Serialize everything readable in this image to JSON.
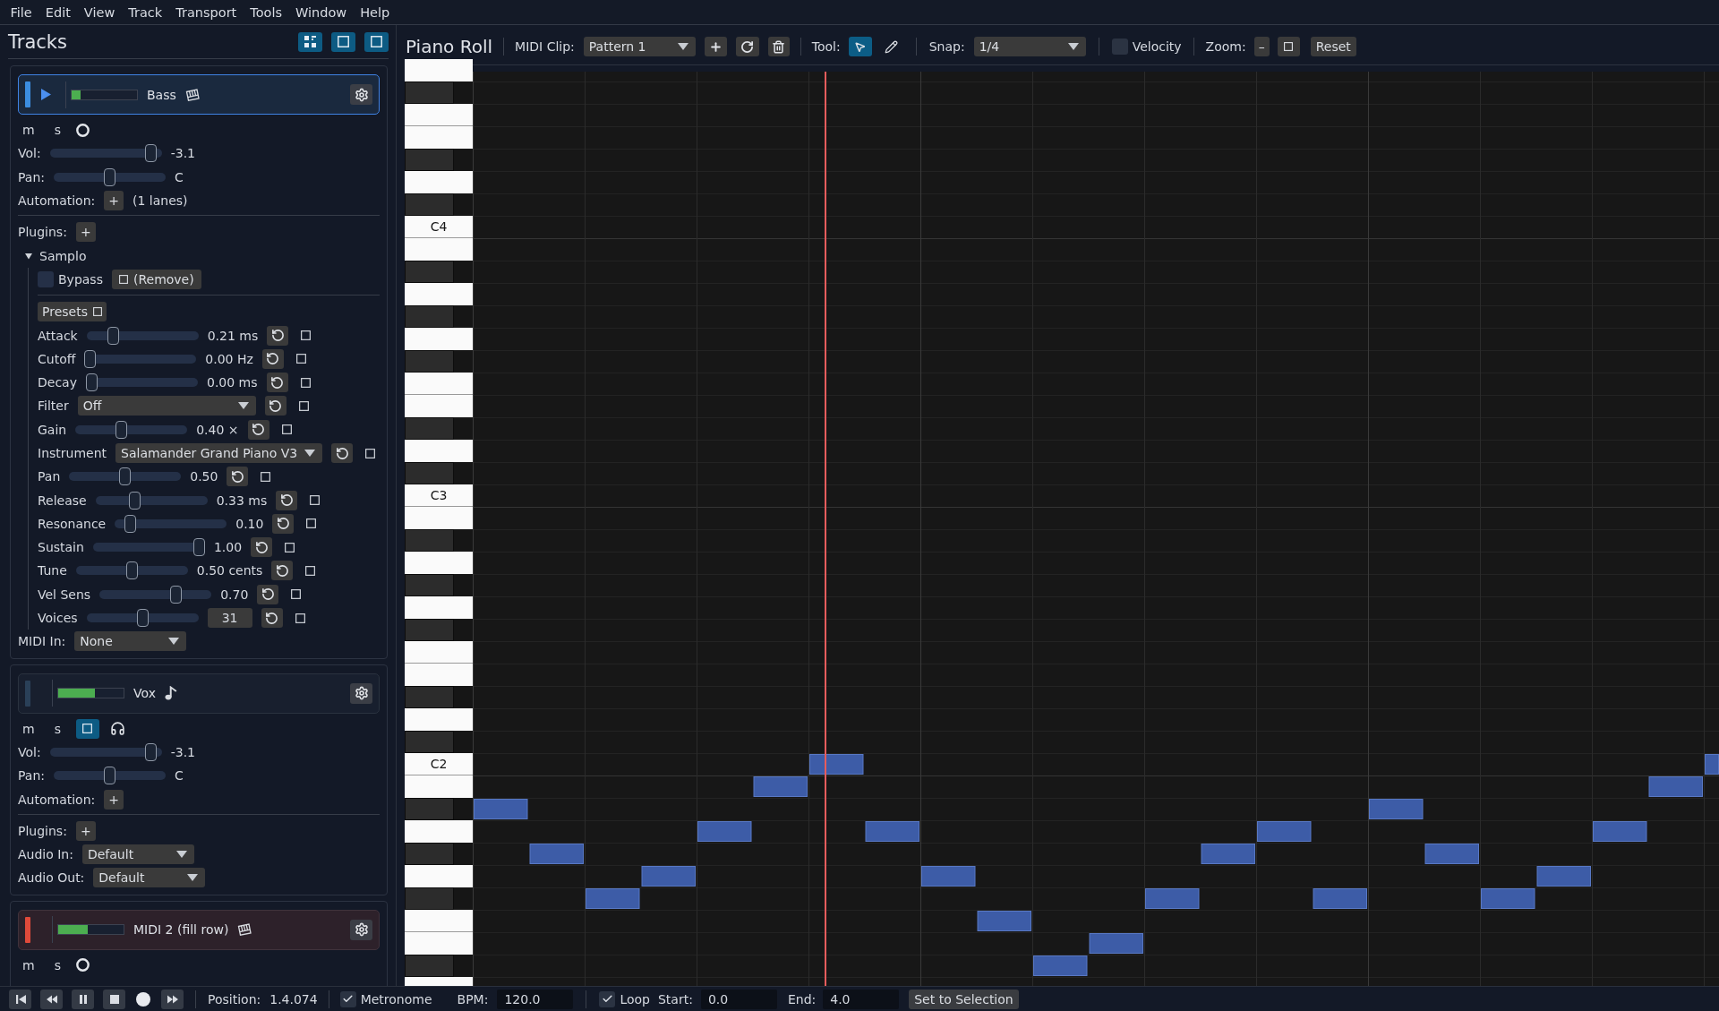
{
  "menu": [
    "File",
    "Edit",
    "View",
    "Track",
    "Transport",
    "Tools",
    "Window",
    "Help"
  ],
  "tracks_panel": {
    "title": "Tracks",
    "tracks": [
      {
        "name": "Bass",
        "kind": "midi",
        "color": "#3b8de0",
        "selected": true,
        "playing": true,
        "meter": {
          "level": 0.14
        },
        "mute": "m",
        "solo": "s",
        "armed": false,
        "volume": {
          "label": "Vol:",
          "level": 0.95,
          "reading": "-3.1"
        },
        "pan": {
          "label": "Pan:",
          "level": 0.5,
          "reading": "C"
        },
        "automation": {
          "label": "Automation:",
          "button": "+",
          "lanes": "(1 lanes)"
        },
        "plugins": {
          "label": "Plugins:",
          "button": "+",
          "items": [
            {
              "name": "Samplo",
              "expanded": true,
              "bypass": {
                "label": "Bypass",
                "checked": false
              },
              "remove": "(Remove)",
              "presets": "Presets",
              "params": [
                {
                  "label": "Attack",
                  "kind": "slider",
                  "level": 0.21,
                  "reading": "0.21 ms"
                },
                {
                  "label": "Cutoff",
                  "kind": "slider",
                  "level": 0.0,
                  "reading": "0.00 Hz"
                },
                {
                  "label": "Decay",
                  "kind": "slider",
                  "level": 0.0,
                  "reading": "0.00 ms"
                },
                {
                  "label": "Filter",
                  "kind": "dropdown",
                  "value": "Off"
                },
                {
                  "label": "Gain",
                  "kind": "slider",
                  "level": 0.4,
                  "reading": "0.40 ×"
                },
                {
                  "label": "Instrument",
                  "kind": "dropdown",
                  "value": "Salamander Grand Piano V3"
                },
                {
                  "label": "Pan",
                  "kind": "slider",
                  "level": 0.5,
                  "reading": "0.50"
                },
                {
                  "label": "Release",
                  "kind": "slider",
                  "level": 0.33,
                  "reading": "0.33 ms"
                },
                {
                  "label": "Resonance",
                  "kind": "slider",
                  "level": 0.1,
                  "reading": "0.10"
                },
                {
                  "label": "Sustain",
                  "kind": "slider",
                  "level": 1.0,
                  "reading": "1.00"
                },
                {
                  "label": "Tune",
                  "kind": "slider",
                  "level": 0.5,
                  "reading": "0.50 cents"
                },
                {
                  "label": "Vel Sens",
                  "kind": "slider",
                  "level": 0.7,
                  "reading": "0.70"
                },
                {
                  "label": "Voices",
                  "kind": "number",
                  "level": 0.5,
                  "value": "31"
                }
              ]
            }
          ]
        },
        "midi_in": {
          "label": "MIDI In:",
          "value": "None"
        }
      },
      {
        "name": "Vox",
        "kind": "audio",
        "color": "#2a4058",
        "selected": false,
        "playing": false,
        "meter": {
          "level": 0.56
        },
        "mute": "m",
        "solo": "s",
        "armed": true,
        "volume": {
          "label": "Vol:",
          "level": 0.95,
          "reading": "-3.1"
        },
        "pan": {
          "label": "Pan:",
          "level": 0.5,
          "reading": "C"
        },
        "automation": {
          "label": "Automation:",
          "button": "+"
        },
        "plugins": {
          "label": "Plugins:",
          "button": "+"
        },
        "audio_in": {
          "label": "Audio In:",
          "value": "Default"
        },
        "audio_out": {
          "label": "Audio Out:",
          "value": "Default"
        }
      },
      {
        "name": "MIDI 2 (fill row)",
        "kind": "midi",
        "color": "#e04a3a",
        "selected": false,
        "playing": false,
        "meter": {
          "level": 0.45
        },
        "mute": "m",
        "solo": "s",
        "armed": false
      }
    ]
  },
  "piano_roll": {
    "title": "Piano Roll",
    "clip": {
      "label": "MIDI Clip:",
      "value": "Pattern 1"
    },
    "tool": {
      "label": "Tool:",
      "tools": [
        {
          "kind": "select",
          "selected": true
        },
        {
          "kind": "pencil",
          "selected": false
        }
      ]
    },
    "snap": {
      "label": "Snap:",
      "value": "1/4"
    },
    "velocity": {
      "label": "Velocity",
      "checked": false
    },
    "zoom": {
      "label": "Zoom:",
      "zoom_out": "–",
      "reset": "Reset"
    },
    "key_labels": [
      "C4",
      "C3",
      "C2"
    ]
  },
  "status_bar": {
    "position": {
      "label": "Position:",
      "value": "1.4.074"
    },
    "metronome": {
      "label": "Metronome",
      "checked": true
    },
    "bpm": {
      "label": "BPM:",
      "value": "120.0"
    },
    "loop": {
      "label": "Loop",
      "checked": true
    },
    "start": {
      "label": "Start:",
      "value": "0.0"
    },
    "end": {
      "label": "End:",
      "value": "4.0"
    },
    "set_selection": "Set to Selection"
  }
}
